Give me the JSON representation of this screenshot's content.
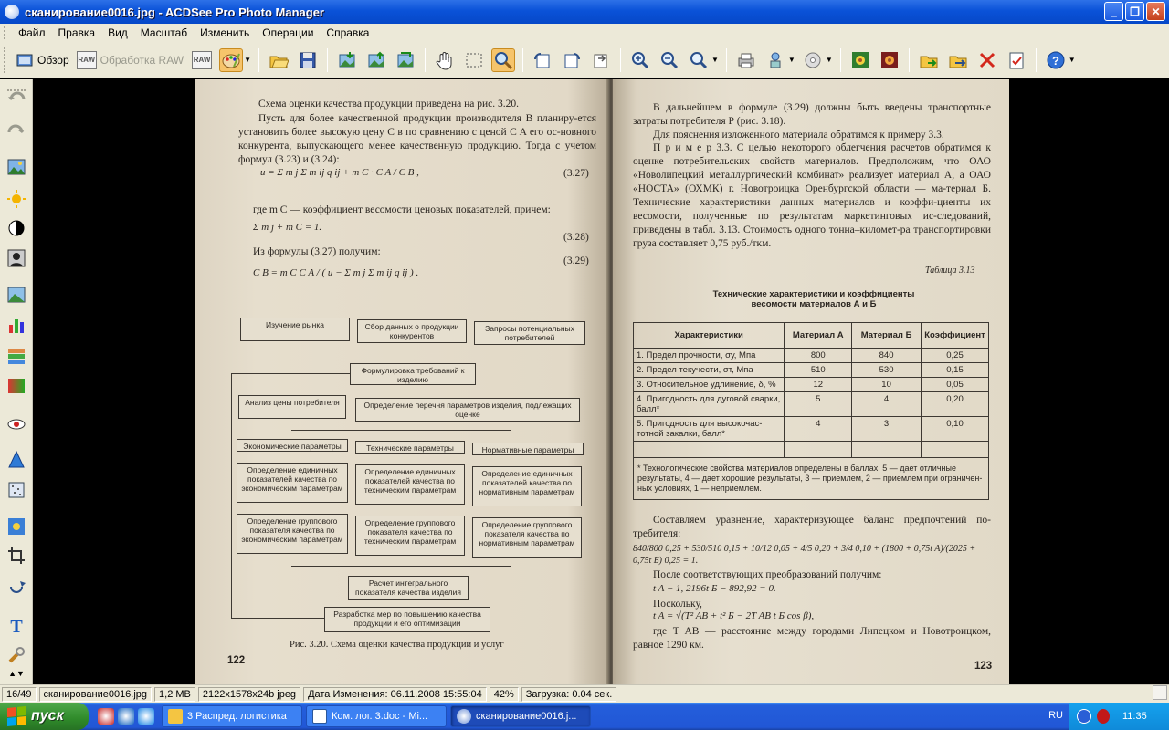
{
  "window": {
    "title": "сканирование0016.jpg - ACDSee Pro Photo Manager"
  },
  "menu": [
    "Файл",
    "Правка",
    "Вид",
    "Масштаб",
    "Изменить",
    "Операции",
    "Справка"
  ],
  "toolbar": {
    "browse_label": "Обзор",
    "raw_label": "Обработка RAW",
    "raw_badge": "RAW"
  },
  "document": {
    "left": {
      "p1": "Схема оценки качества продукции приведена на рис. 3.20.",
      "p2": "Пусть для более качественной продукции производителя В планиру-ется установить более высокую цену C в по сравнению с ценой C A его ос-новного конкурента, выпускающего менее качественную продукцию. Тогда с учетом формул (3.23) и (3.24):",
      "eq1": "u = Σ m j Σ m ij q ij + m C · C A / C B ,",
      "eq1_num": "(3.27)",
      "p3": "где m C — коэффициент весомости ценовых показателей, причем:",
      "eq2": "Σ m j + m C = 1.",
      "eq2_num": "(3.28)",
      "p4": "Из формулы (3.27) получим:",
      "eq3_num": "(3.29)",
      "eq3": "C B = m C C A / ( u − Σ m j Σ m ij q ij ) .",
      "flow": {
        "b1": "Изучение рынка",
        "b2": "Сбор данных о продукции конкурентов",
        "b3": "Запросы потенциальных потребителей",
        "b4": "Формулировка требований к изделию",
        "b5": "Анализ цены потребителя",
        "b6": "Определение перечня параметров изделия, подлежащих оценке",
        "b7": "Экономические параметры",
        "b8": "Технические параметры",
        "b9": "Нормативные параметры",
        "b10": "Определение единичных показателей качества по экономическим параметрам",
        "b11": "Определение единичных показателей качества по техническим параметрам",
        "b12": "Определение единичных показателей качества по нормативным параметрам",
        "b13": "Определение группового показателя качества по экономическим параметрам",
        "b14": "Определение группового показателя качества по техническим параметрам",
        "b15": "Определение группового показателя качества по нормативным параметрам",
        "b16": "Расчет интегрального показателя качества изделия",
        "b17": "Разработка мер по повышению качества продукции и его оптимизации"
      },
      "caption": "Рис. 3.20. Схема оценки качества продукции и услуг",
      "page_no": "122"
    },
    "right": {
      "p1": "В дальнейшем в формуле (3.29) должны быть введены транспортные затраты потребителя Р (рис. 3.18).",
      "p2": "Для пояснения изложенного материала обратимся к примеру 3.3.",
      "p3": "П р и м е р 3.3. С целью некоторого облегчения расчетов обратимся к оценке потребительских свойств материалов. Предположим, что ОАО «Новолипецкий металлургический комбинат» реализует материал А, а ОАО «НОСТА» (ОХМК) г. Новотроицка Оренбургской области — ма-териал Б. Технические характеристики данных материалов и коэффи-циенты их весомости, полученные по результатам маркетинговых ис-следований, приведены в табл. 3.13. Стоимость одного тонна–километ-ра транспортировки груза составляет 0,75 руб./ткм.",
      "table_label": "Таблица 3.13",
      "table_title": "Технические характеристики и коэффициенты весомости материалов А и Б",
      "table": {
        "headers": [
          "Характеристики",
          "Материал А",
          "Материал Б",
          "Коэффициент"
        ],
        "rows": [
          [
            "1. Предел прочности, σу, Мпа",
            "800",
            "840",
            "0,25"
          ],
          [
            "2. Предел текучести, σт, Мпа",
            "510",
            "530",
            "0,15"
          ],
          [
            "3. Относительное удлинение, δ, %",
            "12",
            "10",
            "0,05"
          ],
          [
            "4. Пригодность для дуговой сварки, балл*",
            "5",
            "4",
            "0,20"
          ],
          [
            "5. Пригодность для высокочас-тотной закалки, балл*",
            "4",
            "3",
            "0,10"
          ]
        ],
        "footnote": "* Технологические свойства материалов определены в баллах: 5 — дает отличные результаты, 4 — дает хорошие результаты, 3 — приемлем, 2 — приемлем при ограничен-ных условиях, 1 — неприемлем."
      },
      "p4": "Составляем уравнение, характеризующее баланс предпочтений по-требителя:",
      "eq1": "840/800 0,25 + 530/510 0,15 + 10/12 0,05 + 4/5 0,20 + 3/4 0,10 + (1800 + 0,75t A)/(2025 + 0,75t Б) 0,25 = 1.",
      "p5": "После соответствующих преобразований получим:",
      "eq2": "t A − 1, 2196t Б − 892,92 = 0.",
      "p6": "Поскольку,",
      "eq3": "t A = √(T² AB + t² Б − 2T AB t Б cos β),",
      "p7": "где T AB — расстояние между городами Липецком и Новотроицком, равное 1290 км.",
      "page_no": "123"
    }
  },
  "status": {
    "index": "16/49",
    "filename": "сканирование0016.jpg",
    "size": "1,2 МB",
    "dims": "2122x1578x24b jpeg",
    "modified": "Дата Изменения: 06.11.2008 15:55:04",
    "zoom": "42%",
    "load": "Загрузка: 0.04 сек."
  },
  "taskbar": {
    "start": "пуск",
    "tasks": [
      "3 Распред. логистика",
      "Ком. лог. 3.doc - Mi...",
      "сканирование0016.j..."
    ],
    "lang": "RU",
    "clock": "11:35"
  }
}
